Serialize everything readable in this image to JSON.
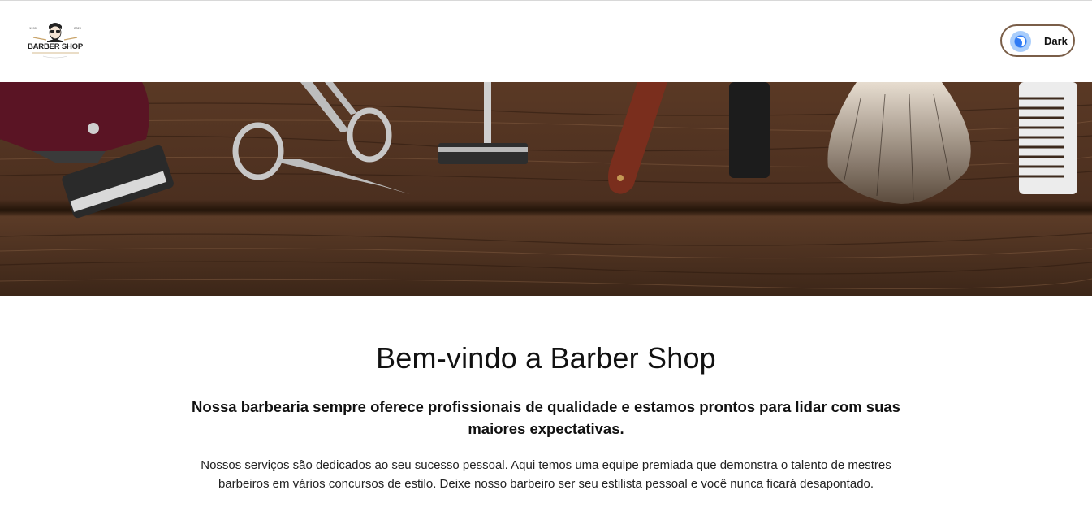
{
  "header": {
    "logo": {
      "text": "BARBER SHOP",
      "year_left": "1990",
      "year_right": "2020"
    },
    "theme_toggle": {
      "label": "Dark",
      "icon": "moon-icon"
    }
  },
  "hero": {
    "image": "barber-tools-on-wood"
  },
  "main": {
    "title": "Bem-vindo a Barber Shop",
    "subtitle": "Nossa barbearia sempre oferece profissionais de qualidade e estamos prontos para lidar com suas maiores expectativas.",
    "body": "Nossos serviços são dedicados ao seu sucesso pessoal. Aqui temos uma equipe premiada que demonstra o talento de mestres barbeiros em vários concursos de estilo. Deixe nosso barbeiro ser seu estilista pessoal e você nunca ficará desapontado."
  },
  "colors": {
    "toggle_border": "#7a5e48",
    "toggle_icon": "#2f7bf5",
    "wood_dark": "#3a2417",
    "wood_light": "#7a5438"
  }
}
